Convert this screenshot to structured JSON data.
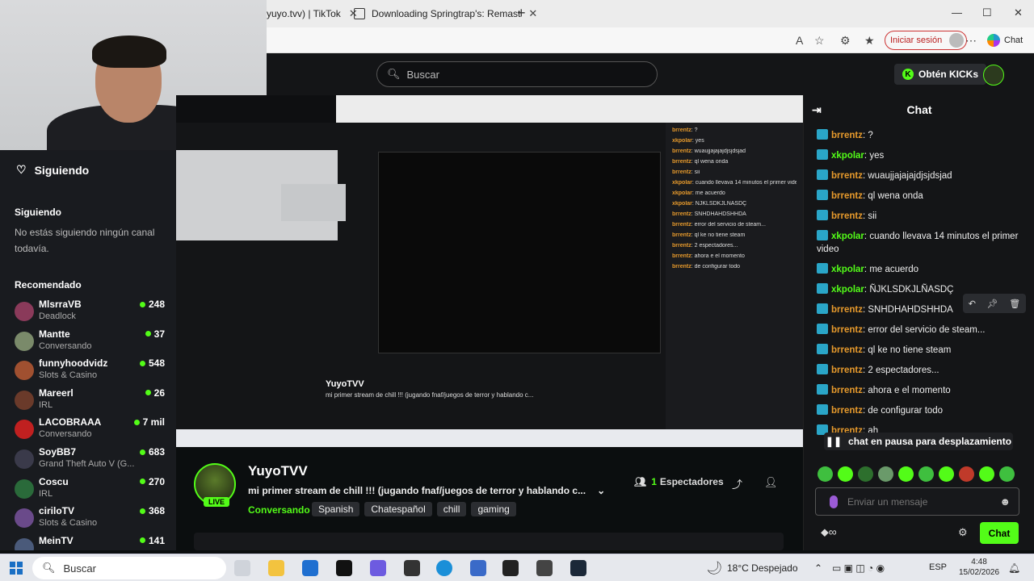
{
  "browser": {
    "tabs": [
      {
        "label": "yuyo.tvv) | TikTok"
      },
      {
        "label": "Downloading Springtrap's: Remast"
      }
    ],
    "signin_label": "Iniciar sesión",
    "copilot_label": "Chat"
  },
  "kick": {
    "search_placeholder": "Buscar",
    "get_kicks_label": "Obtén KICKs"
  },
  "sidebar": {
    "following_title": "Siguiendo",
    "following_heading": "Siguiendo",
    "following_empty": "No estás siguiendo ningún canal todavía.",
    "recommended_heading": "Recomendado",
    "channels": [
      {
        "name": "MlsrraVB",
        "category": "Deadlock",
        "viewers": "248",
        "color": "#8a3a5a"
      },
      {
        "name": "Mantte",
        "category": "Conversando",
        "viewers": "37",
        "color": "#7a8a6a"
      },
      {
        "name": "funnyhoodvidz",
        "category": "Slots & Casino",
        "viewers": "548",
        "color": "#a05030"
      },
      {
        "name": "Mareerl",
        "category": "IRL",
        "viewers": "26",
        "color": "#6a3a2a"
      },
      {
        "name": "LACOBRAAA",
        "category": "Conversando",
        "viewers": "7 mil",
        "color": "#c02020"
      },
      {
        "name": "SoyBB7",
        "category": "Grand Theft Auto V (G...",
        "viewers": "683",
        "color": "#3a3a4a"
      },
      {
        "name": "Coscu",
        "category": "IRL",
        "viewers": "270",
        "color": "#2a6a3a"
      },
      {
        "name": "ciriloTV",
        "category": "Slots & Casino",
        "viewers": "368",
        "color": "#6a4a8a"
      },
      {
        "name": "MeinTV",
        "category": "",
        "viewers": "141",
        "color": "#4a5a7a"
      }
    ]
  },
  "preview": {
    "title": "YuyoTVV",
    "subtitle": "mi primer stream de chill !!! (jugando fnaf/juegos de terror y hablando c..."
  },
  "stream": {
    "streamer": "YuyoTVV",
    "live_label": "LIVE",
    "title": "mi primer stream de chill !!! (jugando fnaf/juegos de terror y hablando c...",
    "category": "Conversando",
    "tags": [
      "Spanish",
      "Chatespañol",
      "chill",
      "gaming"
    ],
    "viewer_count": "1",
    "viewer_label": "Espectadores"
  },
  "chat": {
    "title": "Chat",
    "messages": [
      {
        "user": "brrentz",
        "text": "?",
        "color": "#e79a2c"
      },
      {
        "user": "xkpolar",
        "text": "yes",
        "color": "#53fc18"
      },
      {
        "user": "brrentz",
        "text": "wuaujjajajajdjsjdsjad",
        "color": "#e79a2c"
      },
      {
        "user": "brrentz",
        "text": "ql wena onda",
        "color": "#e79a2c"
      },
      {
        "user": "brrentz",
        "text": "sii",
        "color": "#e79a2c"
      },
      {
        "user": "xkpolar",
        "text": "cuando llevava 14 minutos el primer video",
        "color": "#53fc18"
      },
      {
        "user": "xkpolar",
        "text": "me acuerdo",
        "color": "#53fc18"
      },
      {
        "user": "xkpolar",
        "text": "ÑJKLSDKJLÑASDÇ",
        "color": "#53fc18"
      },
      {
        "user": "brrentz",
        "text": "SNHDHAHDSHHDA",
        "color": "#e79a2c"
      },
      {
        "user": "brrentz",
        "text": "error del servicio de steam...",
        "color": "#e79a2c"
      },
      {
        "user": "brrentz",
        "text": "ql ke no tiene steam",
        "color": "#e79a2c"
      },
      {
        "user": "brrentz",
        "text": "2 espectadores...",
        "color": "#e79a2c"
      },
      {
        "user": "brrentz",
        "text": "ahora e el momento",
        "color": "#e79a2c"
      },
      {
        "user": "brrentz",
        "text": "de configurar todo",
        "color": "#e79a2c"
      },
      {
        "user": "brrentz",
        "text": "ah",
        "color": "#e79a2c"
      }
    ],
    "paused_label": "chat en pausa para desplazamiento",
    "input_placeholder": "Enviar un mensaje",
    "send_label": "Chat"
  },
  "taskbar": {
    "search_placeholder": "Buscar",
    "weather": "18°C  Despejado",
    "language": "ESP",
    "time": "4:48",
    "date": "15/02/2026"
  }
}
